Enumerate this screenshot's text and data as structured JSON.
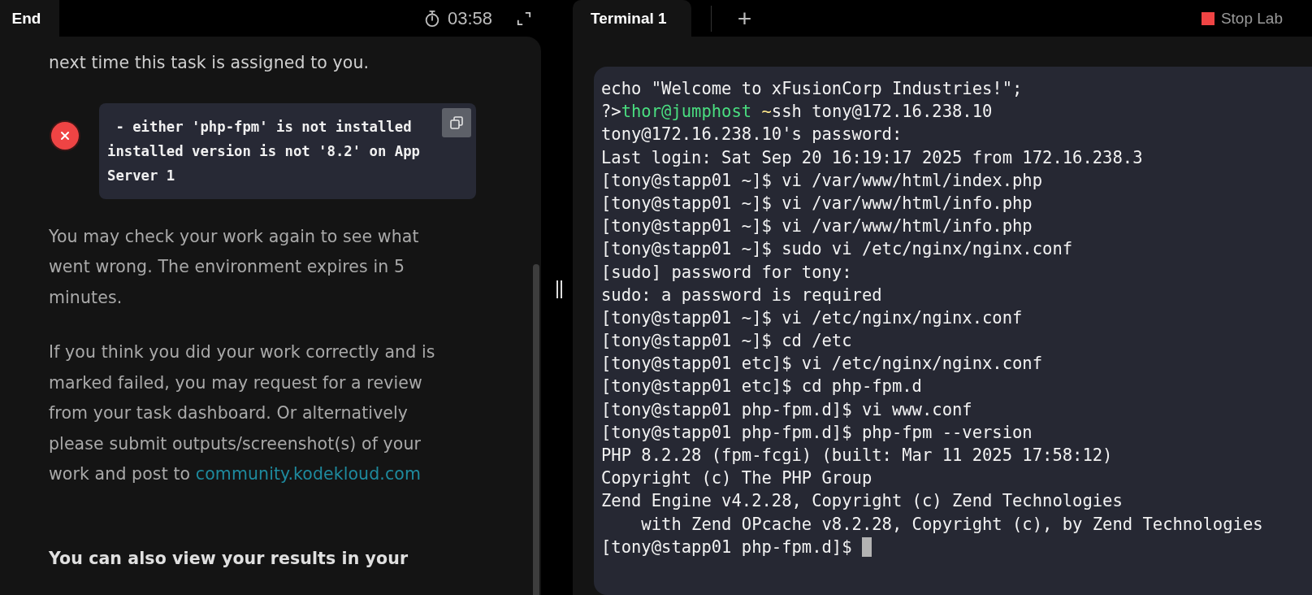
{
  "left_panel": {
    "end_tab": "End",
    "timer": "03:58",
    "intro": "next time this task is assigned to you.",
    "error": {
      "lines": [
        " - either 'php-fpm' is not installed",
        "installed version is not '8.2' on App",
        "Server 1"
      ]
    },
    "paragraphs": [
      "You may check your work again to see what went wrong. The environment expires in 5 minutes.",
      "If you think you did your work correctly and is marked failed, you may request for a review from your task dashboard. Or alternatively please submit outputs/screenshot(s) of your work and post to"
    ],
    "link": "community.kodekloud.com",
    "results_note": "You can also view your results in your"
  },
  "terminal": {
    "tabs": [
      {
        "label": "Terminal 1",
        "selected": true
      }
    ],
    "add_tab": "+",
    "stop_button": "Stop Lab",
    "lines": [
      {
        "kind": "text",
        "text": "echo \"Welcome to xFusionCorp Industries!\";"
      },
      {
        "kind": "parts",
        "parts": [
          {
            "text": "?>",
            "color": "#f2f2f2"
          },
          {
            "text": "thor@jumphost ",
            "color": "#4ade80"
          },
          {
            "text": "~",
            "color": "#fde68a"
          },
          {
            "text": "ssh tony@172.16.238.10",
            "color": "#f2f2f2"
          }
        ]
      },
      {
        "kind": "text",
        "text": "tony@172.16.238.10's password:"
      },
      {
        "kind": "text",
        "text": "Last login: Sat Sep 20 16:19:17 2025 from 172.16.238.3"
      },
      {
        "kind": "text",
        "text": "[tony@stapp01 ~]$ vi /var/www/html/index.php"
      },
      {
        "kind": "text",
        "text": "[tony@stapp01 ~]$ vi /var/www/html/info.php"
      },
      {
        "kind": "text",
        "text": "[tony@stapp01 ~]$ vi /var/www/html/info.php"
      },
      {
        "kind": "text",
        "text": "[tony@stapp01 ~]$ sudo vi /etc/nginx/nginx.conf"
      },
      {
        "kind": "text",
        "text": "[sudo] password for tony:"
      },
      {
        "kind": "text",
        "text": "sudo: a password is required"
      },
      {
        "kind": "text",
        "text": "[tony@stapp01 ~]$ vi /etc/nginx/nginx.conf"
      },
      {
        "kind": "text",
        "text": "[tony@stapp01 ~]$ cd /etc"
      },
      {
        "kind": "text",
        "text": "[tony@stapp01 etc]$ vi /etc/nginx/nginx.conf"
      },
      {
        "kind": "text",
        "text": "[tony@stapp01 etc]$ cd php-fpm.d"
      },
      {
        "kind": "text",
        "text": "[tony@stapp01 php-fpm.d]$ vi www.conf"
      },
      {
        "kind": "text",
        "text": "[tony@stapp01 php-fpm.d]$ php-fpm --version"
      },
      {
        "kind": "text",
        "text": "PHP 8.2.28 (fpm-fcgi) (built: Mar 11 2025 17:58:12)"
      },
      {
        "kind": "text",
        "text": "Copyright (c) The PHP Group"
      },
      {
        "kind": "text",
        "text": "Zend Engine v4.2.28, Copyright (c) Zend Technologies"
      },
      {
        "kind": "text",
        "text": "    with Zend OPcache v8.2.28, Copyright (c), by Zend Technologies"
      },
      {
        "kind": "text",
        "text": "[tony@stapp01 php-fpm.d]$ ",
        "cursor": true
      }
    ]
  }
}
